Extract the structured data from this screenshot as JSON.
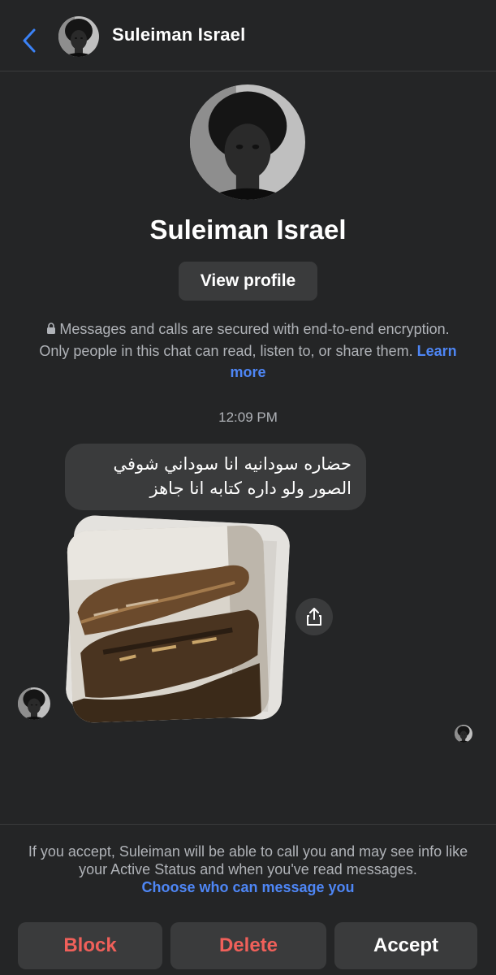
{
  "header": {
    "contact_name": "Suleiman Israel",
    "back_icon": "chevron-left-icon"
  },
  "profile": {
    "name": "Suleiman Israel",
    "view_profile_label": "View profile"
  },
  "encryption": {
    "lock_icon": "lock-icon",
    "text": "Messages and calls are secured with end-to-end encryption. Only people in this chat can read, listen to, or share them.",
    "learn_more": "Learn more"
  },
  "conversation": {
    "timestamp": "12:09 PM",
    "messages": [
      {
        "type": "text",
        "text": "حضاره سودانيه انا سوداني شوفي الصور ولو داره كتابه انا جاهز"
      },
      {
        "type": "image_stack",
        "description": "photo",
        "share_icon": "share-icon"
      }
    ]
  },
  "request": {
    "text": "If you accept, Suleiman will be able to call you and may see info like your Active Status and when you've read messages.",
    "choose_link": "Choose who can message you"
  },
  "actions": {
    "block": "Block",
    "delete": "Delete",
    "accept": "Accept"
  },
  "colors": {
    "background": "#242526",
    "bubble": "#3a3b3c",
    "link": "#4e86f5",
    "destructive": "#f0605a",
    "back_chevron": "#3b82f6"
  }
}
